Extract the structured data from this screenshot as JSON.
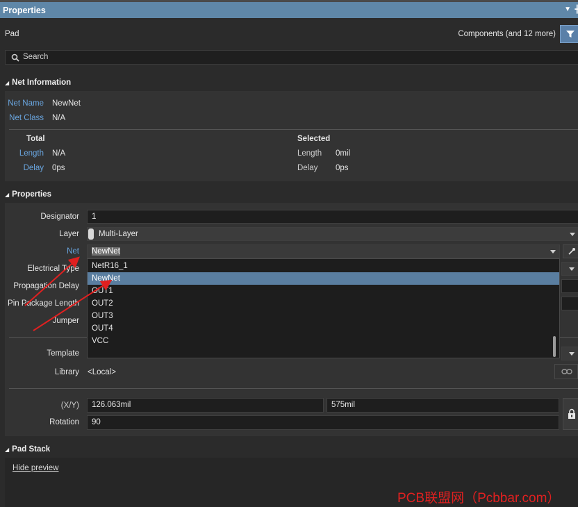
{
  "panel": {
    "title": "Properties",
    "object_type": "Pad",
    "filter_label": "Components (and 12 more)",
    "search_placeholder": "Search"
  },
  "net_information": {
    "header": "Net Information",
    "net_name_label": "Net Name",
    "net_name_value": "NewNet",
    "net_class_label": "Net Class",
    "net_class_value": "N/A",
    "total_header": "Total",
    "selected_header": "Selected",
    "total_length_label": "Length",
    "total_length_value": "N/A",
    "total_delay_label": "Delay",
    "total_delay_value": "0ps",
    "sel_length_label": "Length",
    "sel_length_value": "0mil",
    "sel_delay_label": "Delay",
    "sel_delay_value": "0ps"
  },
  "properties": {
    "header": "Properties",
    "designator_label": "Designator",
    "designator_value": "1",
    "layer_label": "Layer",
    "layer_value": "Multi-Layer",
    "net_label": "Net",
    "net_value": "NewNet",
    "electrical_type_label": "Electrical Type",
    "propagation_delay_label": "Propagation Delay",
    "pin_package_length_label": "Pin Package Length",
    "jumper_label": "Jumper",
    "template_label": "Template",
    "library_label": "Library",
    "library_value": "<Local>",
    "xy_label": "(X/Y)",
    "x_value": "126.063mil",
    "y_value": "575mil",
    "rotation_label": "Rotation",
    "rotation_value": "90"
  },
  "net_dropdown": {
    "options": [
      "NetR16_1",
      "NewNet",
      "OUT1",
      "OUT2",
      "OUT3",
      "OUT4",
      "VCC"
    ],
    "selected": "NewNet"
  },
  "pad_stack": {
    "header": "Pad Stack",
    "hide_preview": "Hide preview"
  },
  "watermark": "PCB联盟网（Pcbbar.com）",
  "colors": {
    "title_bar": "#5f87a8",
    "selection": "#5a7ea0",
    "label_blue": "#6aa6e0",
    "arrow_red": "#e02020"
  },
  "icons": [
    "pin-icon",
    "filter-icon",
    "search-icon",
    "eyedropper-icon",
    "link-icon",
    "lock-icon"
  ]
}
